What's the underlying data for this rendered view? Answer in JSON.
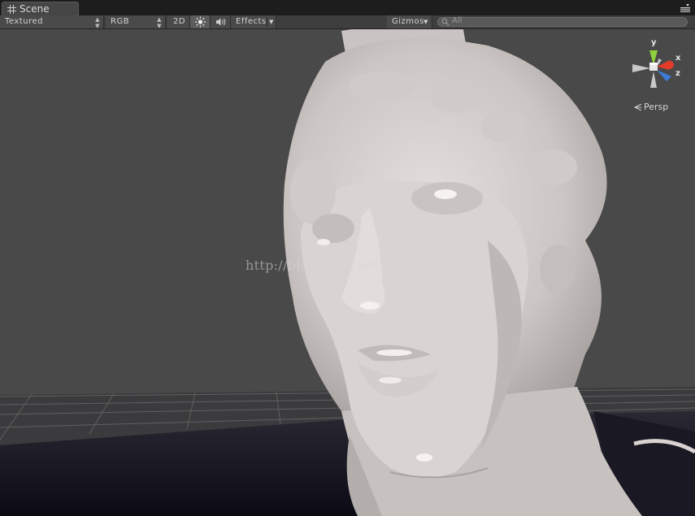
{
  "tab": {
    "label": "Scene",
    "icon": "scene-grid-icon"
  },
  "toolbar": {
    "draw_mode": "Textured",
    "render_mode": "RGB",
    "mode_2d": "2D",
    "lighting_icon": "sun-icon",
    "audio_icon": "speaker-icon",
    "effects": "Effects",
    "gizmos": "Gizmos",
    "search_placeholder": "All"
  },
  "viewport": {
    "watermark": "http://blog.csdn.net/wolf96",
    "gizmo_axes": {
      "y": "y",
      "x": "x",
      "z": "z"
    },
    "projection": "Persp"
  },
  "colors": {
    "axis_y": "#8fd13f",
    "axis_x": "#e23b2a",
    "axis_z": "#3b7bd9",
    "background": "#494949",
    "model": "#cfc9c7"
  }
}
